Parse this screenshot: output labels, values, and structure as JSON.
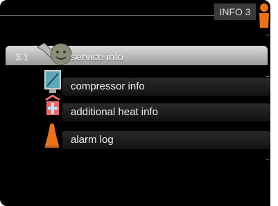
{
  "header": {
    "title": "INFO 3",
    "icon": "info-icon"
  },
  "menu": {
    "number": "3.1",
    "items": [
      {
        "label": "service info",
        "icon": "wrench-smiley-icon",
        "selected": true
      },
      {
        "label": "compressor info",
        "icon": "compressor-icon",
        "selected": false
      },
      {
        "label": "additional heat info",
        "icon": "additional-heat-icon",
        "selected": false
      },
      {
        "label": "alarm log",
        "icon": "alarm-bell-icon",
        "selected": false
      }
    ]
  },
  "colors": {
    "accent": "#e8731a",
    "screen": "#000000",
    "selected_row": "#c8c8c8"
  }
}
